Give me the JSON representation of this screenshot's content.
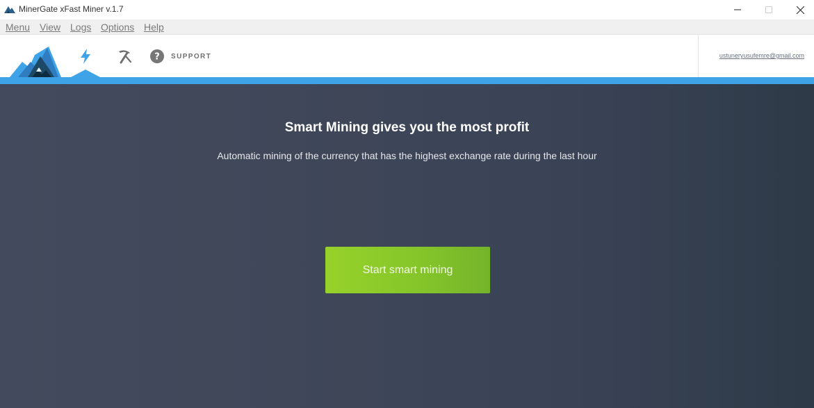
{
  "window": {
    "title": "MinerGate xFast Miner v.1.7"
  },
  "menubar": {
    "items": [
      {
        "label": "Menu"
      },
      {
        "label": "View"
      },
      {
        "label": "Logs"
      },
      {
        "label": "Options"
      },
      {
        "label": "Help"
      }
    ]
  },
  "nav": {
    "items": [
      {
        "id": "smart-mining",
        "icon": "lightning-icon",
        "active": true
      },
      {
        "id": "classic-mining",
        "icon": "pickaxe-icon",
        "active": false
      },
      {
        "id": "support",
        "icon": "question-icon",
        "label": "SUPPORT",
        "active": false
      }
    ]
  },
  "user": {
    "email": "ustuneryusufemre@gmail.com"
  },
  "main": {
    "title": "Smart Mining gives you the most profit",
    "subtitle": "Automatic mining of the currency that has the highest exchange rate during the last hour",
    "start_button_label": "Start smart mining"
  },
  "colors": {
    "accent_blue": "#3fa3e8",
    "background": "#3d4558",
    "button_green": "#8bc82b",
    "logo_dark": "#1d4866"
  }
}
